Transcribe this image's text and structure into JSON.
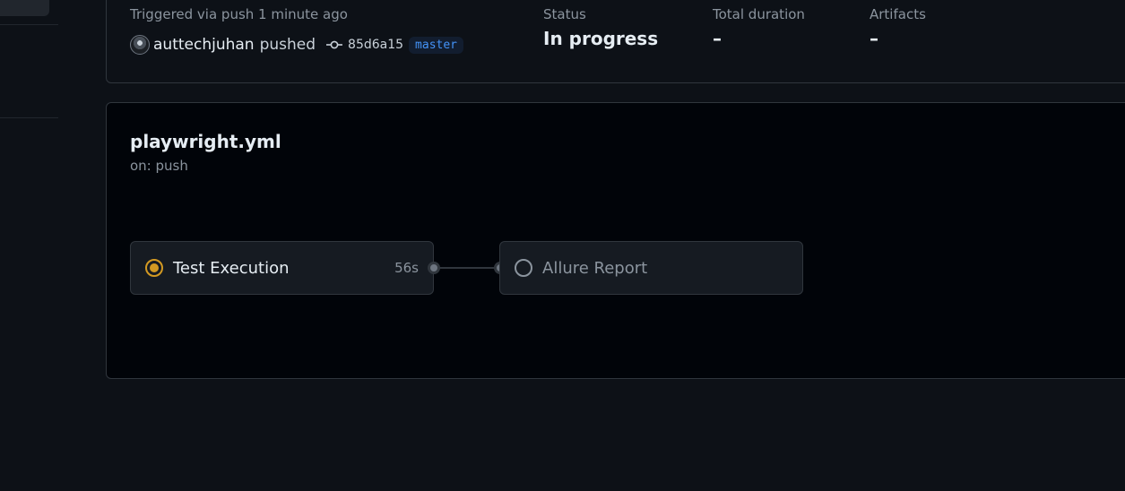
{
  "summary": {
    "trigger_text": "Triggered via push 1 minute ago",
    "actor": "auttechjuhan",
    "action": "pushed",
    "commit_sha": "85d6a15",
    "branch": "master",
    "status_label": "Status",
    "status_value": "In progress",
    "duration_label": "Total duration",
    "duration_value": "–",
    "artifacts_label": "Artifacts",
    "artifacts_value": "–"
  },
  "workflow": {
    "file": "playwright.yml",
    "trigger": "on: push",
    "jobs": [
      {
        "name": "Test Execution",
        "duration": "56s",
        "status": "in-progress",
        "icon": "in-progress-icon"
      },
      {
        "name": "Allure Report",
        "duration": "",
        "status": "queued",
        "icon": "queued-circle-icon"
      }
    ]
  },
  "colors": {
    "in_progress": "#d29922",
    "branch_text": "#4493f8"
  }
}
